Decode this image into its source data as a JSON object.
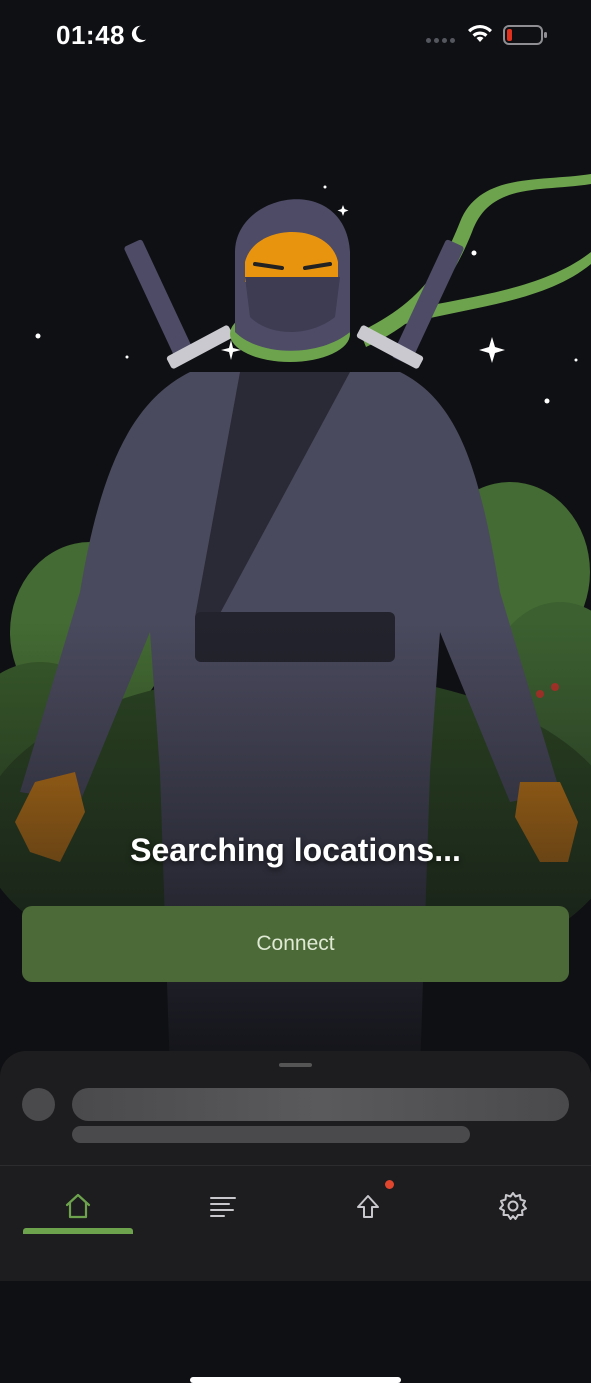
{
  "status_bar": {
    "time": "01:48",
    "icons": [
      "moon-icon",
      "signal-dots-icon",
      "wifi-icon",
      "battery-low-icon"
    ],
    "battery_color": "#e0301e"
  },
  "main": {
    "status_text": "Searching locations...",
    "connect_label": "Connect"
  },
  "bottom_sheet": {
    "loading_placeholder": true
  },
  "tab_bar": {
    "tabs": [
      {
        "icon": "home-icon",
        "active": true
      },
      {
        "icon": "list-icon",
        "active": false
      },
      {
        "icon": "upgrade-arrow-icon",
        "active": false,
        "badge": true
      },
      {
        "icon": "gear-icon",
        "active": false
      }
    ]
  },
  "colors": {
    "accent": "#6da34d",
    "connect_button": "#4b6a37",
    "background": "#0f1014",
    "badge": "#e0452e"
  }
}
